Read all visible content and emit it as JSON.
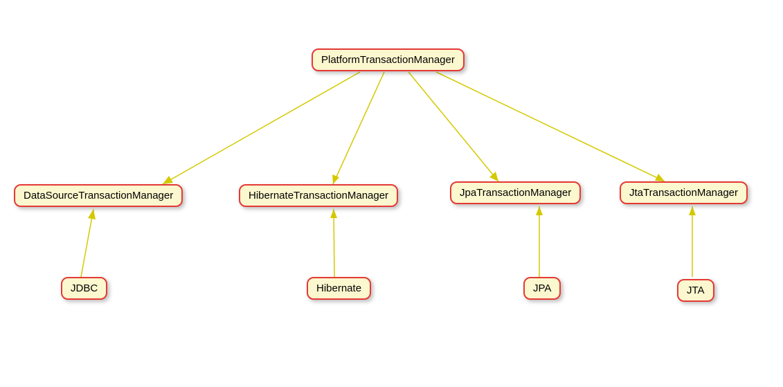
{
  "diagram": {
    "root": {
      "label": "PlatformTransactionManager"
    },
    "managers": [
      {
        "label": "DataSourceTransactionManager"
      },
      {
        "label": "HibernateTransactionManager"
      },
      {
        "label": "JpaTransactionManager"
      },
      {
        "label": "JtaTransactionManager"
      }
    ],
    "techs": [
      {
        "label": "JDBC"
      },
      {
        "label": "Hibernate"
      },
      {
        "label": "JPA"
      },
      {
        "label": "JTA"
      }
    ]
  }
}
